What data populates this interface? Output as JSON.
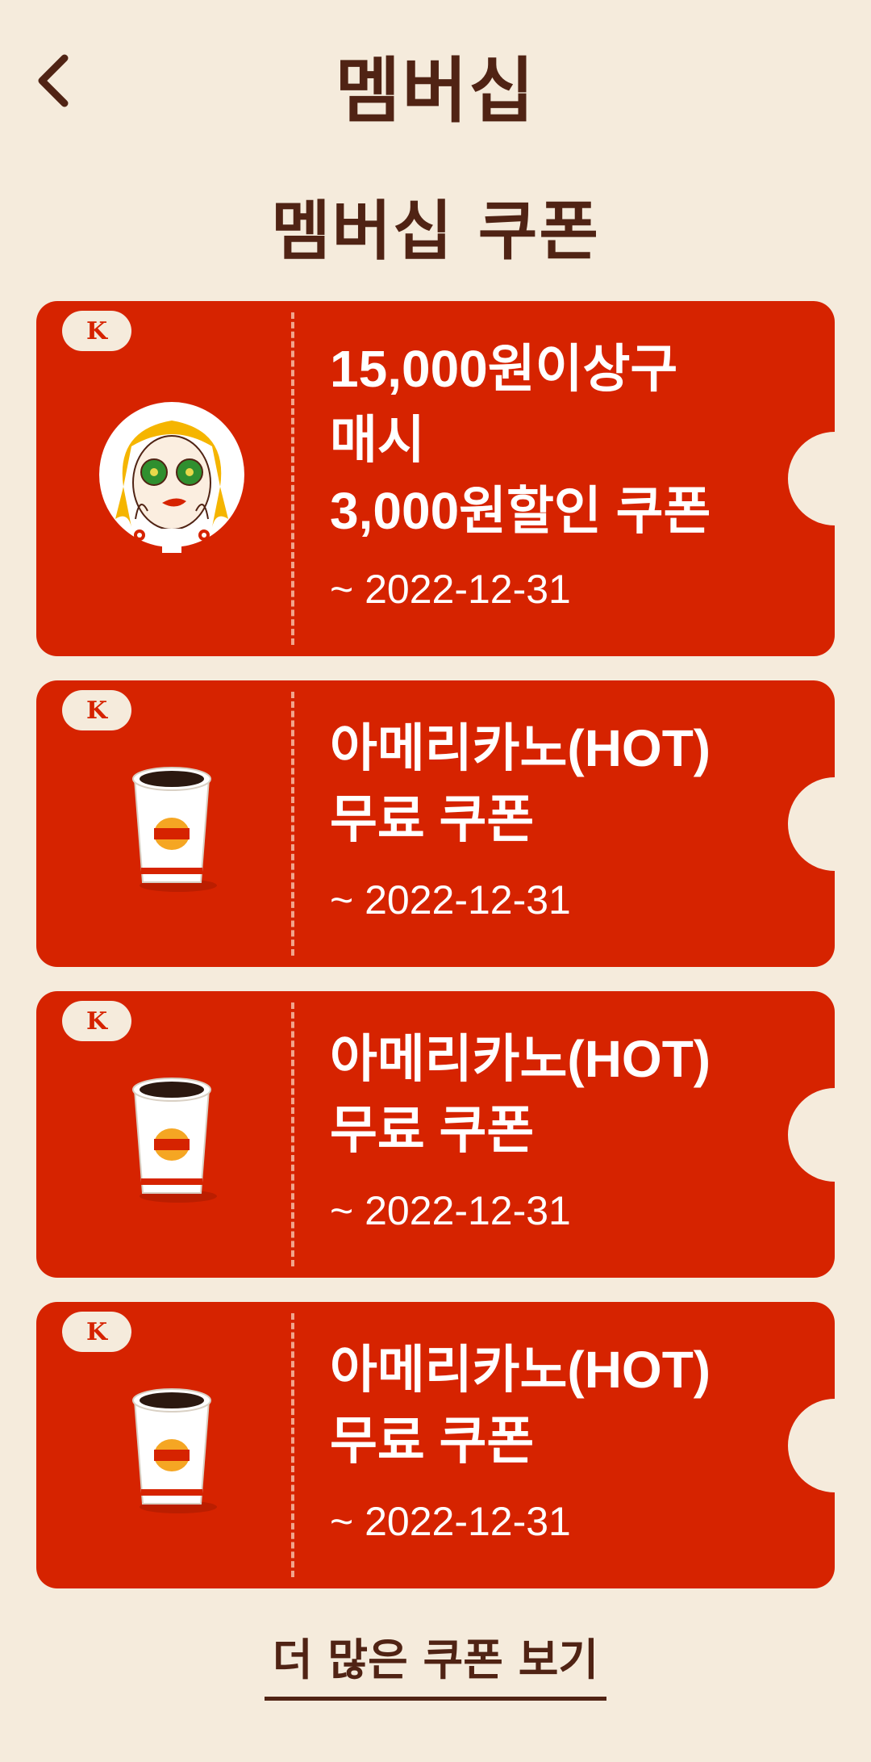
{
  "header": {
    "title": "멤버십",
    "back_icon": "chevron-left-icon"
  },
  "section": {
    "title": "멤버십 쿠폰"
  },
  "coupons": [
    {
      "badge": "K",
      "image": "woman-illustration",
      "title_lines": [
        "15,000원이상구",
        "매시",
        "3,000원할인 쿠폰"
      ],
      "expiry": "~ 2022-12-31"
    },
    {
      "badge": "K",
      "image": "coffee-cup",
      "title_lines": [
        "아메리카노(HOT)",
        "무료 쿠폰"
      ],
      "expiry": "~ 2022-12-31"
    },
    {
      "badge": "K",
      "image": "coffee-cup",
      "title_lines": [
        "아메리카노(HOT)",
        "무료 쿠폰"
      ],
      "expiry": "~ 2022-12-31"
    },
    {
      "badge": "K",
      "image": "coffee-cup",
      "title_lines": [
        "아메리카노(HOT)",
        "무료 쿠폰"
      ],
      "expiry": "~ 2022-12-31"
    }
  ],
  "footer": {
    "more_label": "더 많은 쿠폰 보기"
  },
  "colors": {
    "background": "#f5ebdc",
    "coupon": "#d62300",
    "text_dark": "#502314"
  }
}
